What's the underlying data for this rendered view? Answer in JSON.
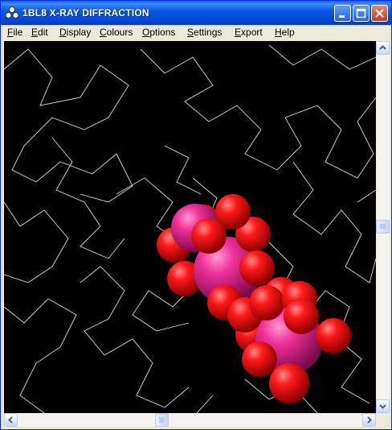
{
  "window": {
    "title": "1BL8 X-RAY DIFFRACTION"
  },
  "menu": {
    "items": [
      {
        "first": "F",
        "rest": "ile"
      },
      {
        "first": "E",
        "rest": "dit"
      },
      {
        "first": "D",
        "rest": "isplay"
      },
      {
        "first": "C",
        "rest": "olours"
      },
      {
        "first": "O",
        "rest": "ptions"
      },
      {
        "first": "S",
        "rest": "ettings"
      },
      {
        "first": "E",
        "rest": "xport"
      },
      {
        "first": "H",
        "rest": "elp"
      }
    ]
  },
  "viewer": {
    "background_color": "#000000",
    "backbone_color": "#ffffff",
    "oxygen_color": "#ff0000",
    "metal_color": "#ff1493",
    "style": "wireframe backbone with spacefill ligand atoms"
  },
  "icons": {
    "app": "molecule-icon",
    "minimize": "minimize-icon",
    "maximize": "maximize-icon",
    "close": "close-icon"
  }
}
